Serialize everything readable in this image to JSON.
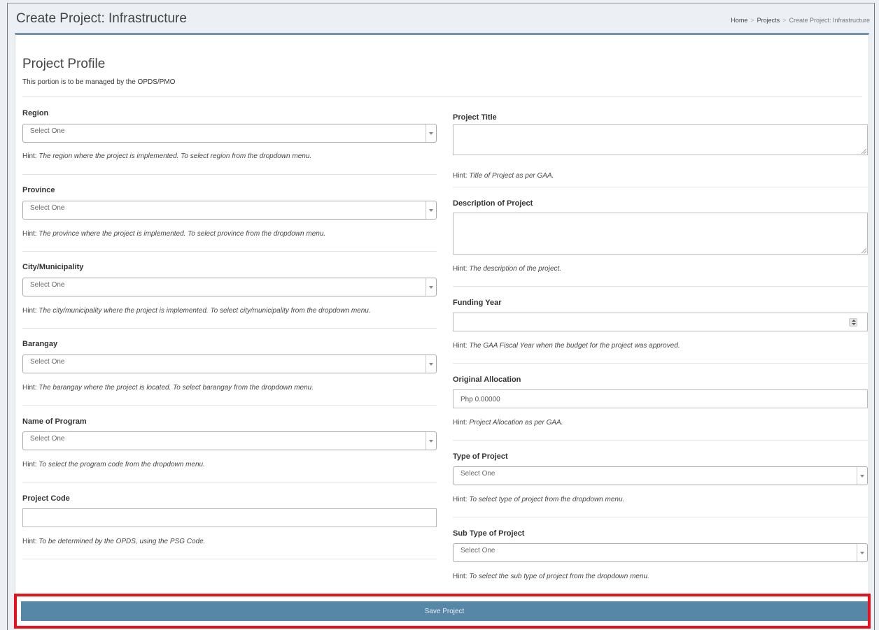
{
  "header": {
    "title": "Create Project: Infrastructure",
    "breadcrumb": {
      "home": "Home",
      "projects": "Projects",
      "current": "Create Project: Infrastructure",
      "separator": ">"
    }
  },
  "profile": {
    "title": "Project Profile",
    "subtitle": "This portion is to be managed by the OPDS/PMO"
  },
  "hint_prefix": "Hint: ",
  "left_fields": [
    {
      "label": "Region",
      "placeholder": "Select One",
      "hint": "The region where the project is implemented. To select region from the dropdown menu."
    },
    {
      "label": "Province",
      "placeholder": "Select One",
      "hint": "The province where the project is implemented. To select province from the dropdown menu."
    },
    {
      "label": "City/Municipality",
      "placeholder": "Select One",
      "hint": "The city/municipality where the project is implemented. To select city/municipality from the dropdown menu."
    },
    {
      "label": "Barangay",
      "placeholder": "Select One",
      "hint": "The barangay where the project is located. To select barangay from the dropdown menu."
    },
    {
      "label": "Name of Program",
      "placeholder": "Select One",
      "hint": "To select the program code from the dropdown menu."
    },
    {
      "label": "Project Code",
      "value": "",
      "hint": "To be determined by the OPDS, using the PSG Code."
    }
  ],
  "right_fields": [
    {
      "label": "Project Title",
      "value": "",
      "hint": "Title of Project as per GAA."
    },
    {
      "label": "Description of Project",
      "value": "",
      "hint": "The description of the project."
    },
    {
      "label": "Funding Year",
      "value": "",
      "hint": "The GAA Fiscal Year when the budget for the project was approved."
    },
    {
      "label": "Original Allocation",
      "value": "Php 0.00000",
      "hint": "Project Allocation as per GAA."
    },
    {
      "label": "Type of Project",
      "placeholder": "Select One",
      "hint": "To select type of project from the dropdown menu."
    },
    {
      "label": "Sub Type of Project",
      "placeholder": "Select One",
      "hint": "To select the sub type of project from the dropdown menu."
    }
  ],
  "save_button": "Save Project",
  "colors": {
    "accent": "#5687a6",
    "highlight": "#e8101a",
    "box_border": "#6f94ad"
  }
}
